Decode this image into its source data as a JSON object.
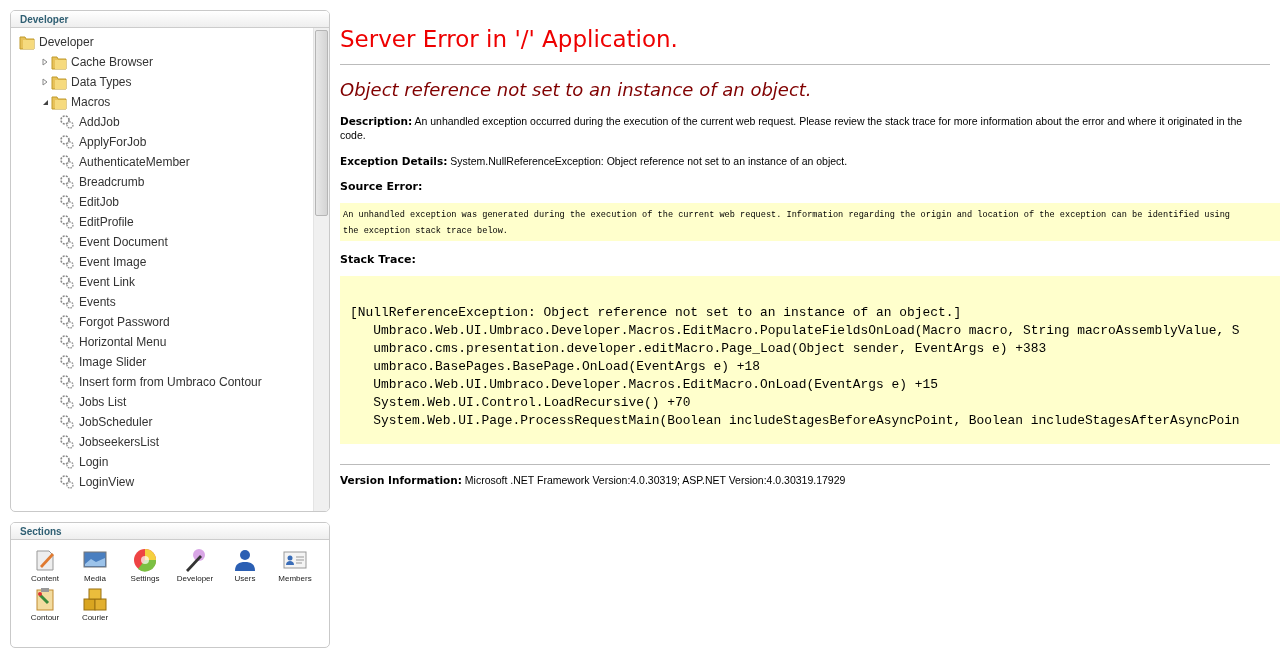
{
  "tree_panel": {
    "title": "Developer",
    "tree": [
      {
        "label": "Developer",
        "kind": "folder",
        "children": [
          {
            "label": "Cache Browser",
            "kind": "folder",
            "expanded": false
          },
          {
            "label": "Data Types",
            "kind": "folder",
            "expanded": false
          },
          {
            "label": "Macros",
            "kind": "folder",
            "expanded": true,
            "children": [
              {
                "label": "AddJob",
                "kind": "macro"
              },
              {
                "label": "ApplyForJob",
                "kind": "macro"
              },
              {
                "label": "AuthenticateMember",
                "kind": "macro"
              },
              {
                "label": "Breadcrumb",
                "kind": "macro"
              },
              {
                "label": "EditJob",
                "kind": "macro"
              },
              {
                "label": "EditProfile",
                "kind": "macro"
              },
              {
                "label": "Event Document",
                "kind": "macro"
              },
              {
                "label": "Event Image",
                "kind": "macro"
              },
              {
                "label": "Event Link",
                "kind": "macro"
              },
              {
                "label": "Events",
                "kind": "macro"
              },
              {
                "label": "Forgot Password",
                "kind": "macro"
              },
              {
                "label": "Horizontal Menu",
                "kind": "macro"
              },
              {
                "label": "Image Slider",
                "kind": "macro"
              },
              {
                "label": "Insert form from Umbraco Contour",
                "kind": "macro"
              },
              {
                "label": "Jobs List",
                "kind": "macro"
              },
              {
                "label": "JobScheduler",
                "kind": "macro"
              },
              {
                "label": "JobseekersList",
                "kind": "macro"
              },
              {
                "label": "Login",
                "kind": "macro"
              },
              {
                "label": "LoginView",
                "kind": "macro"
              }
            ]
          }
        ]
      }
    ]
  },
  "sections_panel": {
    "title": "Sections",
    "items": [
      {
        "label": "Content",
        "kind": "content"
      },
      {
        "label": "Media",
        "kind": "media"
      },
      {
        "label": "Settings",
        "kind": "settings"
      },
      {
        "label": "Developer",
        "kind": "developer"
      },
      {
        "label": "Users",
        "kind": "users"
      },
      {
        "label": "Members",
        "kind": "members"
      },
      {
        "label": "Contour",
        "kind": "contour"
      },
      {
        "label": "Courier",
        "kind": "courier"
      }
    ]
  },
  "error_page": {
    "title": "Server Error in '/' Application.",
    "message": "Object reference not set to an instance of an object.",
    "description": {
      "label": "Description:",
      "text": "An unhandled exception occurred during the execution of the current web request. Please review the stack trace for more information about the error and where it originated in the code."
    },
    "exception_details": {
      "label": "Exception Details:",
      "text": "System.NullReferenceException: Object reference not set to an instance of an object."
    },
    "source_error": {
      "label": "Source Error:",
      "text": "An unhandled exception was generated during the execution of the current web request. Information regarding the origin and location of the exception can be identified using the exception stack trace below."
    },
    "stack_trace": {
      "label": "Stack Trace:",
      "lines": [
        "[NullReferenceException: Object reference not set to an instance of an object.]",
        "   Umbraco.Web.UI.Umbraco.Developer.Macros.EditMacro.PopulateFieldsOnLoad(Macro macro, String macroAssemblyValue, S",
        "   umbraco.cms.presentation.developer.editMacro.Page_Load(Object sender, EventArgs e) +383",
        "   umbraco.BasePages.BasePage.OnLoad(EventArgs e) +18",
        "   Umbraco.Web.UI.Umbraco.Developer.Macros.EditMacro.OnLoad(EventArgs e) +15",
        "   System.Web.UI.Control.LoadRecursive() +70",
        "   System.Web.UI.Page.ProcessRequestMain(Boolean includeStagesBeforeAsyncPoint, Boolean includeStagesAfterAsyncPoin"
      ]
    },
    "version": {
      "label": "Version Information:",
      "text": "Microsoft .NET Framework Version:4.0.30319; ASP.NET Version:4.0.30319.17929"
    }
  }
}
